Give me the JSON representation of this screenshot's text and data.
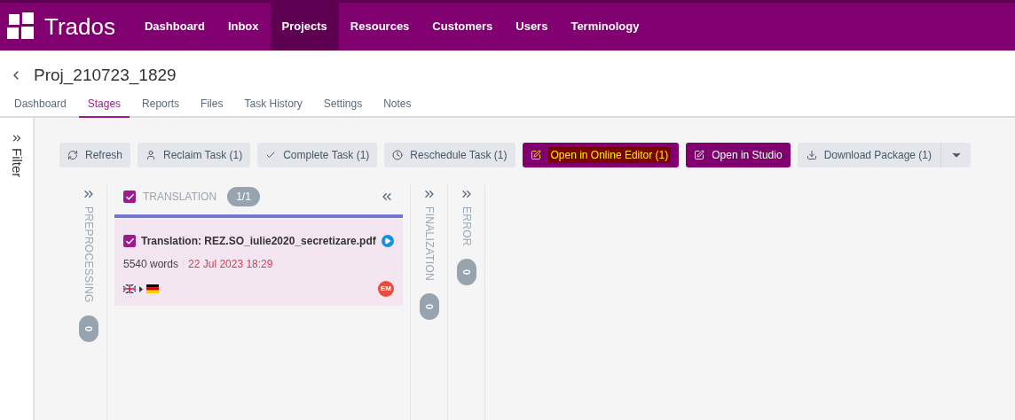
{
  "nav": {
    "logo": "Trados",
    "items": [
      {
        "label": "Dashboard",
        "selected": false
      },
      {
        "label": "Inbox",
        "selected": false
      },
      {
        "label": "Projects",
        "selected": true
      },
      {
        "label": "Resources",
        "selected": false
      },
      {
        "label": "Customers",
        "selected": false
      },
      {
        "label": "Users",
        "selected": false
      },
      {
        "label": "Terminology",
        "selected": false
      }
    ]
  },
  "project": {
    "title": "Proj_210723_1829",
    "tabs": [
      {
        "label": "Dashboard",
        "selected": false
      },
      {
        "label": "Stages",
        "selected": true
      },
      {
        "label": "Reports",
        "selected": false
      },
      {
        "label": "Files",
        "selected": false
      },
      {
        "label": "Task History",
        "selected": false
      },
      {
        "label": "Settings",
        "selected": false
      },
      {
        "label": "Notes",
        "selected": false
      }
    ]
  },
  "filter": {
    "label": "Filter"
  },
  "toolbar": [
    {
      "label": "Refresh",
      "kind": "refresh",
      "highlighted": false
    },
    {
      "label": "Reclaim Task (1)",
      "kind": "user",
      "highlighted": false
    },
    {
      "label": "Complete Task (1)",
      "kind": "check",
      "highlighted": false
    },
    {
      "label": "Reschedule Task (1)",
      "kind": "clock",
      "highlighted": false
    },
    {
      "label": "Open in Online Editor (1)",
      "kind": "edit",
      "highlighted": true
    },
    {
      "label": "Open in Studio",
      "kind": "edit",
      "highlighted": false
    },
    {
      "label": "Download Package (1)",
      "kind": "download",
      "highlighted": false
    }
  ],
  "stages": [
    {
      "kind": "collapsed",
      "name": "PREPROCESSING",
      "count": "0"
    },
    {
      "kind": "expanded",
      "name": "TRANSLATION",
      "count": "1/1",
      "checked": true,
      "cards": [
        {
          "checked": true,
          "title": "Translation: REZ.SO_iulie2020_secretizare.pdf",
          "words": "5540 words",
          "due": "22 Jul 2023 18:29",
          "assignee": "EM"
        }
      ]
    },
    {
      "kind": "collapsed",
      "name": "FINALIZATION",
      "count": "0"
    },
    {
      "kind": "collapsed",
      "name": "ERROR",
      "count": "0"
    }
  ]
}
